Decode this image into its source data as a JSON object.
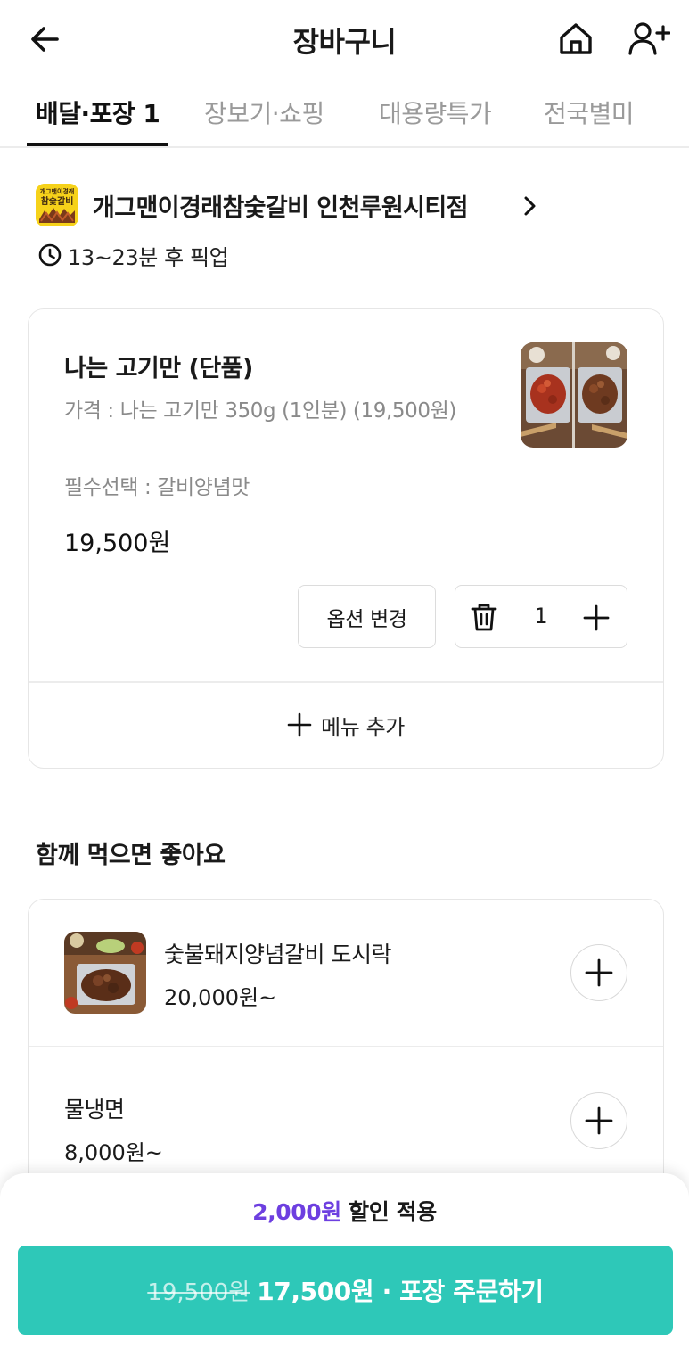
{
  "header": {
    "title": "장바구니",
    "back_icon": "arrow-left-icon",
    "home_icon": "home-icon",
    "user_add_icon": "user-plus-icon"
  },
  "tabs": [
    {
      "label": "배달·포장 1",
      "active": true
    },
    {
      "label": "장보기·쇼핑",
      "active": false
    },
    {
      "label": "대용량특가",
      "active": false
    },
    {
      "label": "전국별미",
      "active": false
    }
  ],
  "store": {
    "logo_text_top": "개그맨이경래",
    "logo_text_bottom": "참숯갈비",
    "name": "개그맨이경래참숯갈비 인천루원시티점",
    "pickup_time": "13~23분 후 픽업"
  },
  "cart_item": {
    "name": "나는 고기만 (단품)",
    "option_price": "가격 : 나는 고기만 350g (1인분) (19,500원)",
    "required": "필수선택 : 갈비양념맛",
    "price": "19,500원",
    "option_change_label": "옵션 변경",
    "quantity": "1",
    "add_menu_label": "메뉴 추가"
  },
  "recommendation": {
    "title": "함께 먹으면 좋아요",
    "items": [
      {
        "name": "숯불돼지양념갈비 도시락",
        "price": "20,000원~"
      },
      {
        "name": "물냉면",
        "price": "8,000원~"
      }
    ]
  },
  "bottom": {
    "discount_amount": "2,000원",
    "discount_text": " 할인 적용",
    "original_price": "19,500원",
    "order_label": "17,500원 · 포장 주문하기"
  },
  "colors": {
    "accent": "#2ec8b8",
    "discount": "#6d3fe0",
    "logo_bg": "#f6d21a"
  }
}
